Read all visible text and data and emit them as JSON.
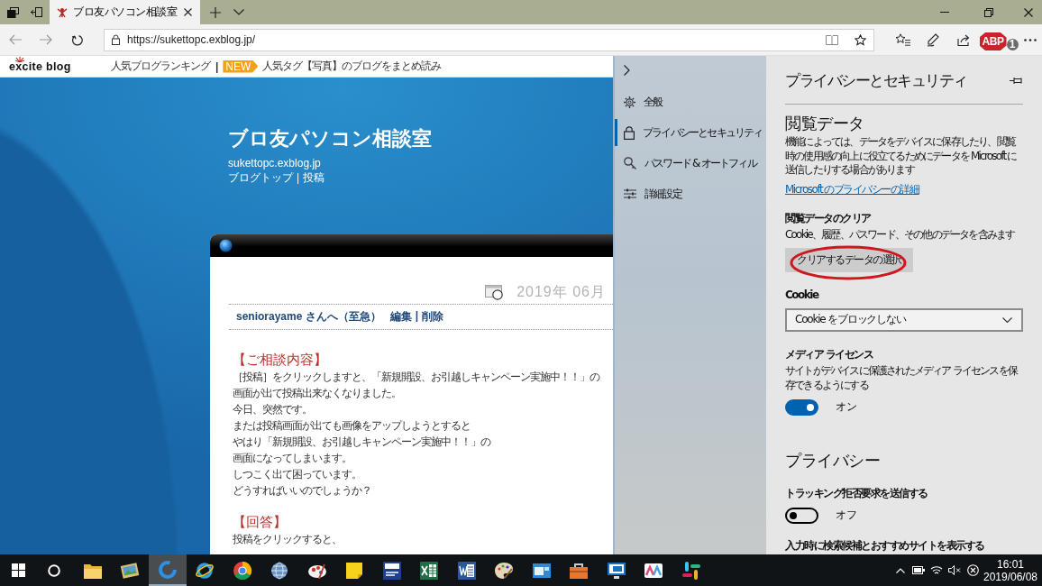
{
  "browser": {
    "tabs": [
      {
        "title": "ブロ友パソコン相談室",
        "selected": true
      }
    ],
    "address": {
      "url": "https://sukettopc.exblog.jp/"
    },
    "extension": {
      "label": "ABP",
      "count": "1"
    }
  },
  "blog": {
    "topbar": {
      "logo": "excite blog",
      "separator": "|",
      "links": [
        {
          "label": "人気ブログランキング"
        },
        {
          "label": "人気タグ【写真】のブログをまとめ読み",
          "badge": "NEW"
        }
      ]
    },
    "header": {
      "title": "ブロ友パソコン相談室",
      "url": "sukettopc.exblog.jp",
      "separator": "|",
      "links": [
        "ブログトップ",
        "投稿"
      ]
    },
    "post": {
      "date": "2019年 06月",
      "title": "seniorayame さんへ（至急）",
      "separator": "|",
      "actions": [
        "編集",
        "削除"
      ],
      "body": [
        {
          "kind": "heading",
          "text": "【ご相談内容】"
        },
        {
          "kind": "line",
          "text": "［投稿］をクリックしますと、「新規開設、お引越しキャンペーン実施中！！」の"
        },
        {
          "kind": "line",
          "text": "画面が出て投稿出来なくなりました。"
        },
        {
          "kind": "line",
          "text": "今日、突然です。"
        },
        {
          "kind": "line",
          "text": "または投稿画面が出ても画像をアップしようとすると"
        },
        {
          "kind": "line",
          "text": "やはり「新規開設、お引越しキャンペーン実施中！！」の"
        },
        {
          "kind": "line",
          "text": "画面になってしまいます。"
        },
        {
          "kind": "line",
          "text": "しつこく出て困っています。"
        },
        {
          "kind": "line",
          "text": "どうすればいいのでしょうか？"
        },
        {
          "kind": "heading",
          "text": "【回答】"
        },
        {
          "kind": "line",
          "text": "投稿をクリックすると、"
        }
      ]
    }
  },
  "settings": {
    "nav": [
      {
        "label": "全般",
        "selected": false
      },
      {
        "label": "プライバシーとセキュリティ",
        "selected": true
      },
      {
        "label": "パスワード & オートフィル",
        "selected": false
      },
      {
        "label": "詳細設定",
        "selected": false
      }
    ],
    "panel": {
      "title": "プライバシーとセキュリティ",
      "items": [
        {
          "kind": "heading",
          "text": "閲覧データ"
        },
        {
          "kind": "text",
          "text": "機能によっては、データをデバイスに保存したり、閲覧時の使用感の向上に役立てるためにデータを Microsoft に送信したりする場合があります"
        },
        {
          "kind": "link",
          "text": "Microsoft のプライバシーの詳細"
        },
        {
          "kind": "label",
          "text": "閲覧データのクリア"
        },
        {
          "kind": "text",
          "text": "Cookie、履歴、パスワード、その他のデータを含みます"
        },
        {
          "kind": "button",
          "text": "クリアするデータの選択",
          "highlighted": true
        },
        {
          "kind": "label",
          "text": "Cookie"
        },
        {
          "kind": "select",
          "value": "Cookie をブロックしない"
        },
        {
          "kind": "label",
          "text": "メディア ライセンス"
        },
        {
          "kind": "text",
          "text": "サイトがデバイスに保護されたメディア ライセンスを保存できるようにする"
        },
        {
          "kind": "toggle",
          "on": true,
          "text": "オン"
        },
        {
          "kind": "heading",
          "text": "プライバシー"
        },
        {
          "kind": "label",
          "text": "トラッキング拒否要求を送信する"
        },
        {
          "kind": "toggle",
          "on": false,
          "text": "オフ"
        },
        {
          "kind": "label",
          "text": "入力時に検索候補とおすすめサイトを表示する"
        }
      ]
    }
  },
  "taskbar": {
    "apps": [
      {
        "selected": false
      },
      {
        "selected": false
      },
      {
        "selected": true
      },
      {
        "selected": false
      },
      {
        "selected": false
      },
      {
        "selected": false
      },
      {
        "selected": false
      },
      {
        "selected": false
      },
      {
        "selected": false
      },
      {
        "selected": false
      },
      {
        "selected": false
      },
      {
        "selected": false
      },
      {
        "selected": false
      },
      {
        "selected": false
      },
      {
        "selected": false
      },
      {
        "selected": false
      },
      {
        "selected": false
      }
    ],
    "clock": {
      "time": "16:01",
      "date": "2019/06/08"
    }
  }
}
